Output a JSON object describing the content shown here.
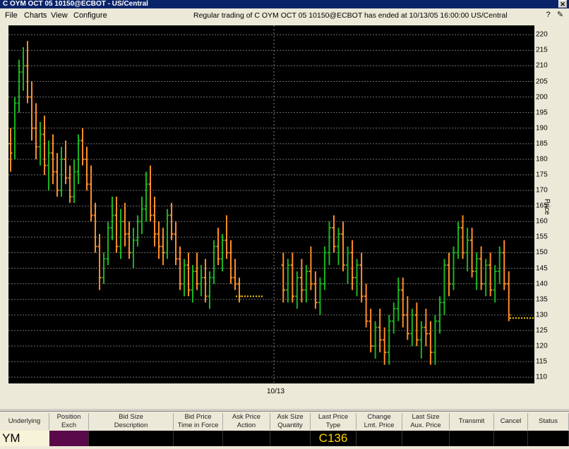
{
  "window": {
    "title": "C OYM  OCT 05  10150@ECBOT - US/Central"
  },
  "menu": [
    {
      "label": "File"
    },
    {
      "label": "Charts"
    },
    {
      "label": "View"
    },
    {
      "label": "Configure"
    }
  ],
  "status_message": "Regular trading of C OYM  OCT 05  10150@ECBOT has ended at 10/13/05 16:00:00 US/Central",
  "icons": {
    "help": "question-icon",
    "pin": "pin-icon",
    "close": "close-icon"
  },
  "chart_data": {
    "type": "bar",
    "title": "",
    "xlabel": "",
    "x_tick_labels": [
      "10/13"
    ],
    "ylabel": "Price",
    "ylim": [
      108,
      223
    ],
    "yticks": [
      110,
      115,
      120,
      125,
      130,
      135,
      140,
      145,
      150,
      155,
      160,
      165,
      170,
      175,
      180,
      185,
      190,
      195,
      200,
      205,
      210,
      215,
      220
    ],
    "grid": true,
    "last_values": [
      136.0,
      129.0
    ],
    "series": [
      {
        "values": [
          [
            185,
            190,
            176,
            182
          ],
          [
            190,
            200,
            180,
            198
          ],
          [
            198,
            212,
            195,
            208
          ],
          [
            208,
            216,
            202,
            210
          ],
          [
            210,
            218,
            198,
            200
          ],
          [
            200,
            205,
            186,
            190
          ],
          [
            190,
            198,
            180,
            184
          ],
          [
            184,
            192,
            178,
            188
          ],
          [
            188,
            194,
            175,
            178
          ],
          [
            178,
            186,
            170,
            182
          ],
          [
            182,
            188,
            172,
            176
          ],
          [
            176,
            182,
            168,
            170
          ],
          [
            170,
            184,
            168,
            180
          ],
          [
            180,
            186,
            172,
            174
          ],
          [
            174,
            178,
            166,
            168
          ],
          [
            168,
            180,
            166,
            176
          ],
          [
            176,
            188,
            172,
            186
          ],
          [
            186,
            190,
            178,
            180
          ],
          [
            180,
            184,
            170,
            172
          ],
          [
            172,
            178,
            160,
            162
          ],
          [
            162,
            166,
            150,
            152
          ],
          [
            152,
            156,
            138,
            142
          ],
          [
            142,
            150,
            140,
            148
          ],
          [
            148,
            160,
            146,
            158
          ],
          [
            158,
            168,
            154,
            162
          ],
          [
            162,
            168,
            150,
            152
          ],
          [
            152,
            164,
            148,
            160
          ],
          [
            160,
            166,
            152,
            156
          ],
          [
            156,
            160,
            148,
            150
          ],
          [
            150,
            158,
            145,
            154
          ],
          [
            154,
            162,
            152,
            160
          ],
          [
            160,
            168,
            156,
            164
          ],
          [
            164,
            176,
            160,
            172
          ],
          [
            172,
            178,
            160,
            162
          ],
          [
            162,
            168,
            152,
            156
          ],
          [
            156,
            160,
            148,
            152
          ],
          [
            152,
            158,
            146,
            150
          ],
          [
            150,
            164,
            148,
            162
          ],
          [
            162,
            166,
            154,
            156
          ],
          [
            156,
            160,
            146,
            148
          ],
          [
            148,
            152,
            138,
            140
          ],
          [
            140,
            148,
            136,
            146
          ],
          [
            146,
            150,
            136,
            138
          ],
          [
            138,
            146,
            134,
            144
          ],
          [
            144,
            150,
            138,
            140
          ],
          [
            140,
            146,
            136,
            142
          ],
          [
            142,
            148,
            134,
            136
          ],
          [
            136,
            144,
            132,
            142
          ],
          [
            142,
            154,
            140,
            152
          ],
          [
            152,
            158,
            146,
            148
          ],
          [
            148,
            156,
            144,
            154
          ],
          [
            154,
            162,
            148,
            150
          ],
          [
            150,
            154,
            140,
            142
          ],
          [
            142,
            148,
            138,
            140
          ],
          [
            140,
            142,
            134,
            136
          ]
        ]
      },
      {
        "values": [
          [
            146,
            150,
            134,
            138
          ],
          [
            138,
            148,
            134,
            146
          ],
          [
            146,
            150,
            134,
            136
          ],
          [
            136,
            144,
            132,
            142
          ],
          [
            142,
            148,
            134,
            138
          ],
          [
            138,
            146,
            134,
            144
          ],
          [
            144,
            152,
            138,
            140
          ],
          [
            140,
            144,
            132,
            134
          ],
          [
            134,
            142,
            130,
            140
          ],
          [
            140,
            152,
            138,
            150
          ],
          [
            150,
            160,
            146,
            158
          ],
          [
            158,
            162,
            150,
            152
          ],
          [
            152,
            158,
            146,
            156
          ],
          [
            156,
            160,
            144,
            146
          ],
          [
            146,
            152,
            140,
            150
          ],
          [
            150,
            154,
            138,
            142
          ],
          [
            142,
            148,
            136,
            146
          ],
          [
            146,
            150,
            134,
            136
          ],
          [
            136,
            140,
            126,
            128
          ],
          [
            128,
            132,
            118,
            120
          ],
          [
            120,
            128,
            116,
            126
          ],
          [
            126,
            132,
            118,
            122
          ],
          [
            122,
            126,
            114,
            118
          ],
          [
            118,
            130,
            114,
            128
          ],
          [
            128,
            134,
            124,
            132
          ],
          [
            132,
            142,
            128,
            138
          ],
          [
            138,
            142,
            126,
            130
          ],
          [
            130,
            136,
            122,
            124
          ],
          [
            124,
            132,
            120,
            130
          ],
          [
            130,
            134,
            120,
            122
          ],
          [
            122,
            128,
            116,
            126
          ],
          [
            126,
            132,
            120,
            124
          ],
          [
            124,
            128,
            114,
            118
          ],
          [
            118,
            130,
            114,
            128
          ],
          [
            128,
            136,
            124,
            134
          ],
          [
            134,
            148,
            130,
            146
          ],
          [
            146,
            150,
            136,
            140
          ],
          [
            140,
            152,
            138,
            150
          ],
          [
            150,
            160,
            148,
            158
          ],
          [
            158,
            162,
            148,
            150
          ],
          [
            150,
            158,
            144,
            154
          ],
          [
            154,
            158,
            142,
            144
          ],
          [
            144,
            150,
            138,
            148
          ],
          [
            148,
            152,
            138,
            140
          ],
          [
            140,
            148,
            136,
            146
          ],
          [
            146,
            150,
            136,
            138
          ],
          [
            138,
            146,
            134,
            144
          ],
          [
            144,
            152,
            140,
            150
          ],
          [
            150,
            154,
            138,
            140
          ],
          [
            140,
            144,
            128,
            130
          ]
        ]
      }
    ],
    "colors": {
      "up": "#19b41f",
      "down": "#ff8c28",
      "neutral": "#c8c8c8",
      "last": "#ffd400",
      "background": "#000000",
      "grid": "#6f6f6f"
    }
  },
  "order_panel": {
    "columns": [
      {
        "line1": "",
        "line2": "Underlying"
      },
      {
        "line1": "Position",
        "line2": "Exch"
      },
      {
        "line1": "Bid Size",
        "line2": "Description"
      },
      {
        "line1": "Bid Price",
        "line2": "Time in Force"
      },
      {
        "line1": "Ask Price",
        "line2": "Action"
      },
      {
        "line1": "Ask Size",
        "line2": "Quantity"
      },
      {
        "line1": "Last Price",
        "line2": "Type"
      },
      {
        "line1": "Change",
        "line2": "Lmt. Price"
      },
      {
        "line1": "Last Size",
        "line2": "Aux. Price"
      },
      {
        "line1": "",
        "line2": "Transmit"
      },
      {
        "line1": "",
        "line2": "Cancel"
      },
      {
        "line1": "",
        "line2": "Status"
      }
    ],
    "underlying_value": "YM",
    "type_value": "C136",
    "colors": {
      "exch_cell": "#5a0a4a",
      "type_text": "#ffd400"
    }
  }
}
